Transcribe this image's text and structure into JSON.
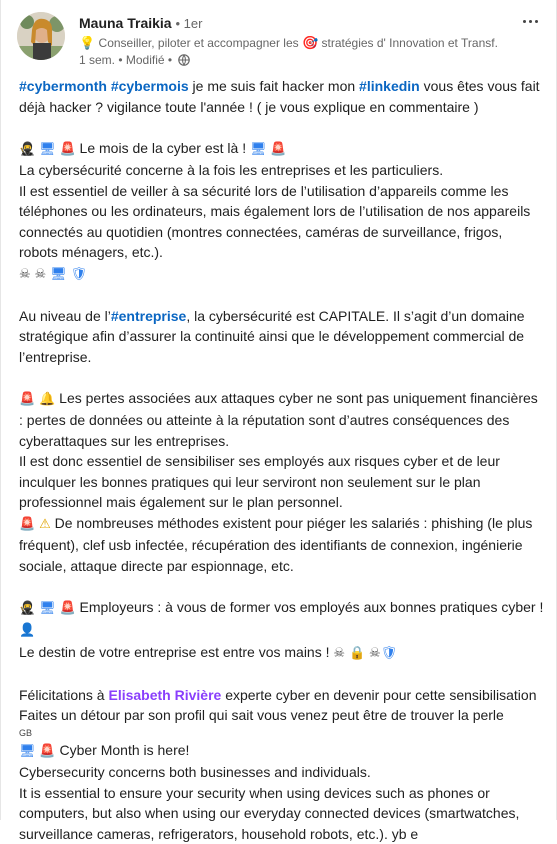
{
  "author": {
    "name": "Mauna Traikia",
    "degree": "1er",
    "headline": "Conseiller, piloter et accompagner les",
    "headline_rest": "stratégies d' Innovation et Transf...",
    "meta": "1 sem. • Modifié •"
  },
  "icons": {
    "menu": "more-options-icon",
    "globe": "globe-icon"
  },
  "colors": {
    "hashtag": "#0a66c2",
    "mention": "#8a3ffc"
  },
  "post": {
    "p1_tags": [
      "#cybermonth",
      "#cybermois"
    ],
    "p1_text1": " je me suis fait hacker mon ",
    "p1_tag3": "#linkedin",
    "p1_text2": " vous êtes vous fait déjà hacker ? vigilance toute l'année ! ( je vous explique en commentaire )",
    "p2_title": " Le mois de la cyber est là ! ",
    "p2_l1": "La cybersécurité concerne à la fois les entreprises et les particuliers.",
    "p2_l2": "Il est essentiel de veiller à sa sécurité lors de l’utilisation d’appareils comme les téléphones ou les ordinateurs, mais également lors de l’utilisation de nos appareils connectés au quotidien (montres connectées, caméras de surveillance, frigos, robots ménagers, etc.).",
    "p3_a": "Au niveau de l’",
    "p3_tag": "#entreprise",
    "p3_b": ", la cybersécurité est CAPITALE. Il s’agit d’un domaine stratégique afin d’assurer la continuité ainsi que le développement commercial de l’entreprise.",
    "p4_l1": " Les pertes associées aux attaques cyber ne sont pas uniquement financières : pertes de données ou atteinte à la réputation sont d’autres conséquences des cyberattaques sur les entreprises.",
    "p4_l2": "Il est donc essentiel de sensibiliser ses employés aux risques cyber et de leur inculquer les bonnes pratiques qui leur serviront non seulement sur le plan professionnel mais également sur le plan personnel.",
    "p4_l3": " De nombreuses méthodes existent pour piéger les salariés : phishing (le plus fréquent), clef usb infectée, récupération des identifiants de connexion, ingénierie sociale, attaque directe par espionnage, etc.",
    "p5_l1": " Employeurs : à vous de former vos employés aux bonnes pratiques cyber ! ",
    "p5_l2": "Le destin de votre entreprise est entre vos mains ! ",
    "p6_a": "Félicitations à ",
    "p6_mention": "Elisabeth Rivière",
    "p6_b": " experte cyber en devenir pour cette sensibilisation",
    "p6_l2": "Faites un détour par son profil qui sait vous venez peut être de trouver la perle",
    "gb": "GB",
    "en_l1": " Cyber Month is here!",
    "en_l2": "Cybersecurity concerns both businesses and individuals.",
    "en_l3": "It is essential to ensure your security when using devices such as phones or computers, but also when using our everyday connected devices (smartwatches, surveillance cameras, refrigerators, household robots, etc.). yb e"
  }
}
